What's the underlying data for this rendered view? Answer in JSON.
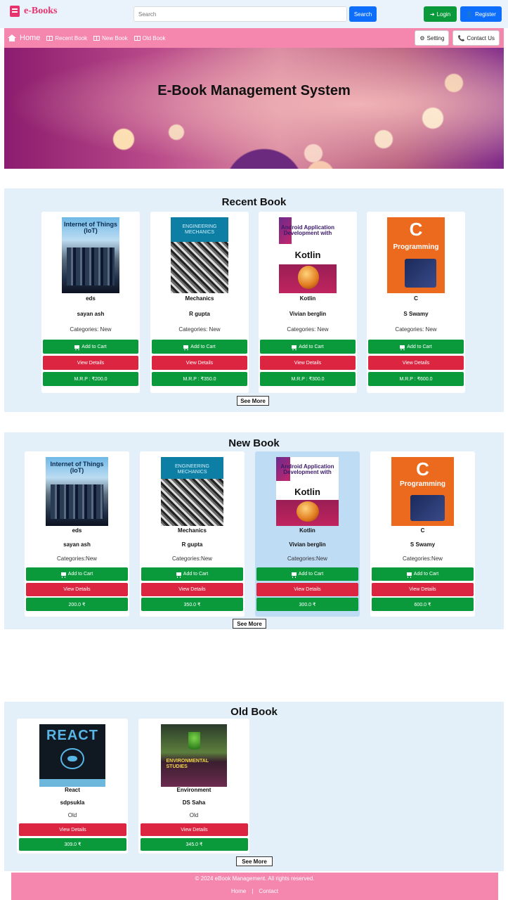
{
  "brand": {
    "name": "e-Books"
  },
  "header": {
    "search_placeholder": "Search",
    "search_button": "Search",
    "login": "Login",
    "register": "Register"
  },
  "nav": {
    "home": "Home",
    "recent": "Recent Book",
    "new": "New Book",
    "old": "Old Book",
    "setting": "Setting",
    "contact": "Contact Us"
  },
  "hero": {
    "title": "E-Book Management System"
  },
  "recent": {
    "title": "Recent Book",
    "see_more": "See More",
    "books": [
      {
        "cover_text": "Internet of Things (IoT)",
        "name": "eds",
        "author": "sayan ash",
        "category": "Categories: New",
        "add": "Add to Cart",
        "view": "View Details",
        "price": "M.R.P : ₹200.0"
      },
      {
        "cover_text": "ENGINEERING MECHANICS",
        "name": "Mechanics",
        "author": "R gupta",
        "category": "Categories: New",
        "add": "Add to Cart",
        "view": "View Details",
        "price": "M.R.P : ₹350.0"
      },
      {
        "cover_text": "Android Application Development with",
        "cover_big": "Kotlin",
        "name": "Kotlin",
        "author": "Vivian berglin",
        "category": "Categories: New",
        "add": "Add to Cart",
        "view": "View Details",
        "price": "M.R.P : ₹300.0"
      },
      {
        "cover_big": "C",
        "cover_text": "Programming",
        "name": "C",
        "author": "S Swamy",
        "category": "Categories: New",
        "add": "Add to Cart",
        "view": "View Details",
        "price": "M.R.P : ₹600.0"
      }
    ]
  },
  "new": {
    "title": "New Book",
    "see_more": "See More",
    "books": [
      {
        "cover_text": "Internet of Things (IoT)",
        "name": "eds",
        "author": "sayan ash",
        "category": "Categories:New",
        "add": "Add to Cart",
        "view": "View Details",
        "price": "200.0 ₹"
      },
      {
        "cover_text": "ENGINEERING MECHANICS",
        "name": "Mechanics",
        "author": "R gupta",
        "category": "Categories:New",
        "add": "Add to Cart",
        "view": "View Details",
        "price": "350.0 ₹"
      },
      {
        "cover_text": "Android Application Development with",
        "cover_big": "Kotlin",
        "name": "Kotlin",
        "author": "Vivian berglin",
        "category": "Categories:New",
        "add": "Add to Cart",
        "view": "View Details",
        "price": "300.0 ₹"
      },
      {
        "cover_big": "C",
        "cover_text": "Programming",
        "name": "C",
        "author": "S Swamy",
        "category": "Categories:New",
        "add": "Add to Cart",
        "view": "View Details",
        "price": "600.0 ₹"
      }
    ]
  },
  "old": {
    "title": "Old Book",
    "see_more": "See More",
    "books": [
      {
        "cover_big": "REACT",
        "name": "React",
        "author": "sdpsukla",
        "category": "Old",
        "view": "View Details",
        "price": "309.0 ₹"
      },
      {
        "cover_text": "ENVIRONMENTAL STUDIES",
        "name": "Environment",
        "author": "DS Saha",
        "category": "Old",
        "view": "View Details",
        "price": "345.0 ₹"
      }
    ]
  },
  "footer": {
    "copyright": "© 2024 eBook Management. All rights reserved.",
    "home": "Home",
    "separator": "|",
    "contact": "Contact"
  }
}
